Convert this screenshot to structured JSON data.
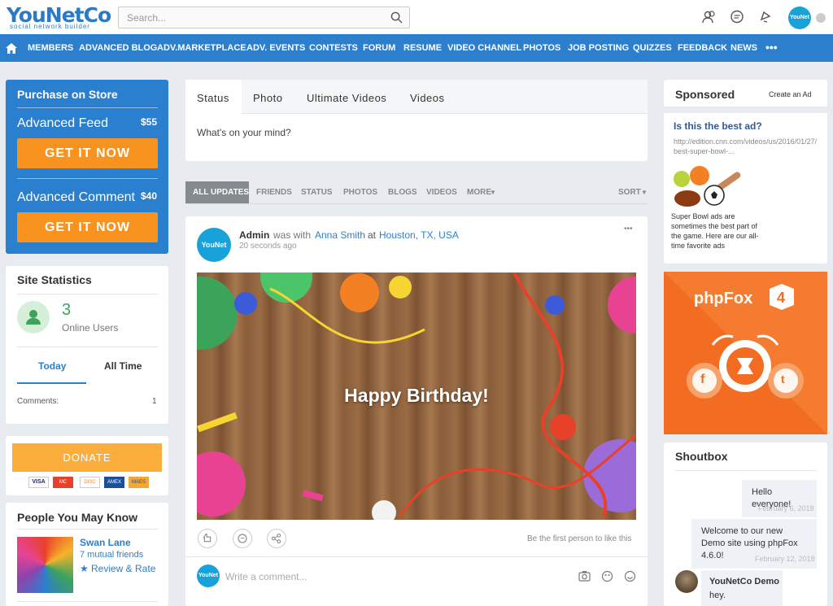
{
  "brand": {
    "name": "YouNetCo",
    "tagline": "social network builder"
  },
  "search": {
    "placeholder": "Search..."
  },
  "user": {
    "avatar_text": "YouNet"
  },
  "nav": [
    "MEMBERS",
    "ADVANCED BLOG",
    "ADV.MARKETPLACE",
    "ADV. EVENTS",
    "CONTESTS",
    "FORUM",
    "RESUME",
    "VIDEO CHANNEL",
    "PHOTOS",
    "JOB POSTING",
    "QUIZZES",
    "FEEDBACK",
    "NEWS"
  ],
  "purchase": {
    "title": "Purchase on Store",
    "items": [
      {
        "name": "Advanced Feed",
        "price": "$55",
        "button": "GET IT NOW"
      },
      {
        "name": "Advanced Comment",
        "price": "$40",
        "button": "GET IT NOW"
      }
    ]
  },
  "stats": {
    "title": "Site Statistics",
    "count": "3",
    "label": "Online Users",
    "tabs": [
      "Today",
      "All Time"
    ],
    "row_label": "Comments:",
    "row_value": "1"
  },
  "donate": {
    "button": "DONATE",
    "cards": [
      "VISA",
      "MC",
      "DISC",
      "AMEX",
      "MAES"
    ]
  },
  "pymk": {
    "title": "People You May Know",
    "name": "Swan Lane",
    "mutual": "7 mutual friends",
    "rate": "Review & Rate"
  },
  "composer": {
    "tabs": [
      "Status",
      "Photo",
      "Ultimate Videos",
      "Videos"
    ],
    "placeholder": "What's on your mind?"
  },
  "feed_tabs": [
    "ALL UPDATES",
    "FRIENDS",
    "STATUS",
    "PHOTOS",
    "BLOGS",
    "VIDEOS",
    "MORE"
  ],
  "sort": "SORT",
  "post": {
    "author": "Admin",
    "was_with": "was with",
    "with_name": "Anna Smith",
    "at": "at",
    "location": "Houston, TX, USA",
    "time": "20 seconds ago",
    "image_text": "Happy Birthday!",
    "like_hint": "Be the first person to like this",
    "comment_placeholder": "Write a comment..."
  },
  "sponsored": {
    "title": "Sponsored",
    "create": "Create an Ad",
    "ad_title": "Is this the best ad?",
    "ad_url": "http://edition.cnn.com/videos/us/2016/01/27/best-super-bowl-...",
    "ad_desc": "Super Bowl ads are sometimes the best part of the game. Here are our all-time favorite ads"
  },
  "phpfox": {
    "name": "phpFox",
    "version": "4"
  },
  "shoutbox": {
    "title": "Shoutbox",
    "messages": [
      {
        "text": "Hello everyone!",
        "date": "February 6, 2018"
      },
      {
        "text": "Welcome to our new Demo site using phpFox 4.6.0!",
        "date": "February 12, 2018"
      },
      {
        "author": "YouNetCo Demo",
        "text": "hey."
      }
    ]
  }
}
